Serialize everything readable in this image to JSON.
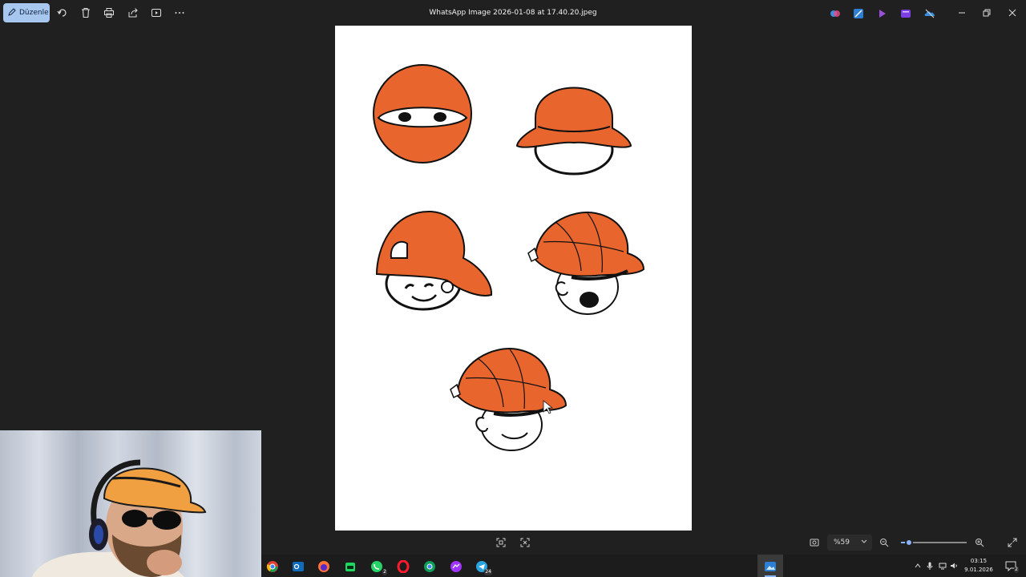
{
  "window": {
    "title": "WhatsApp Image 2026-01-08 at 17.40.20.jpeg",
    "edit_label": "Düzenle"
  },
  "toolbar_icons": [
    "edit-pencil-icon",
    "rotate-icon",
    "delete-icon",
    "print-icon",
    "share-icon",
    "slideshow-icon",
    "more-icon"
  ],
  "app_icons": [
    "copilot-icon",
    "photos-editor-icon",
    "clipchamp-icon",
    "video-editor-icon",
    "onedrive-icon"
  ],
  "window_controls": [
    "minimize-icon",
    "restore-icon",
    "close-icon"
  ],
  "bottom_toolbar": {
    "zoom_value": "%59",
    "zoom_fraction": 0.12
  },
  "taskbar": {
    "apps": [
      {
        "name": "chrome",
        "badge": ""
      },
      {
        "name": "outlook",
        "badge": ""
      },
      {
        "name": "firefox",
        "badge": ""
      },
      {
        "name": "store",
        "badge": ""
      },
      {
        "name": "whatsapp",
        "badge": "2"
      },
      {
        "name": "opera",
        "badge": ""
      },
      {
        "name": "chrome-profile",
        "badge": ""
      },
      {
        "name": "messenger",
        "badge": ""
      },
      {
        "name": "telegram",
        "badge": "24"
      },
      {
        "name": "photos",
        "badge": ""
      }
    ],
    "time": "03:15",
    "date": "9.01.2026",
    "notification_count": "2"
  },
  "colors": {
    "accent": "#a7c7ee",
    "cap_orange": "#e8662e",
    "background": "#202020"
  }
}
